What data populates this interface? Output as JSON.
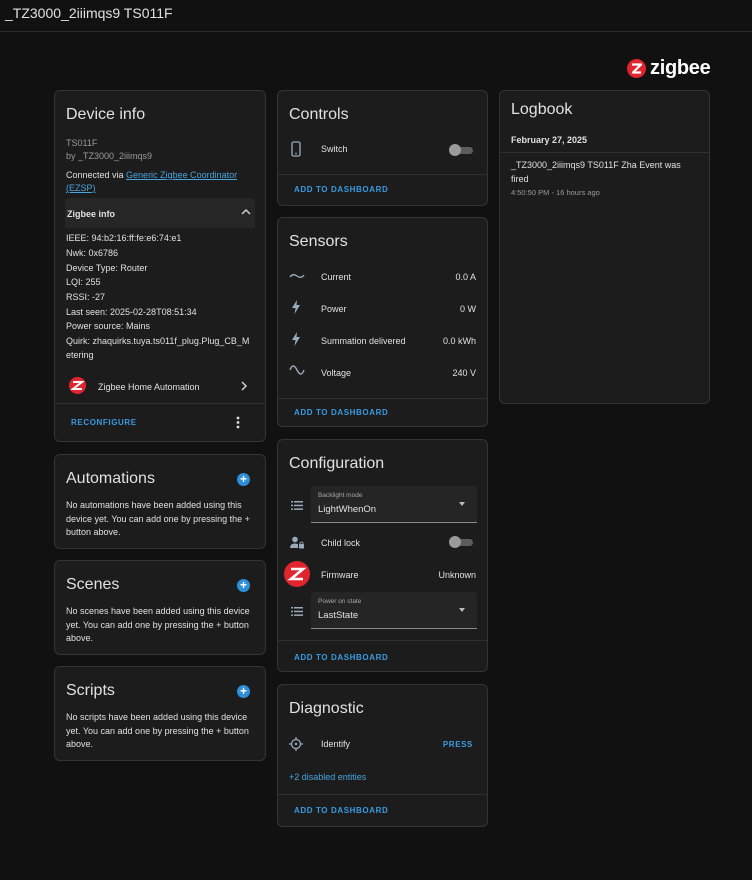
{
  "header": {
    "title": "_TZ3000_2iiimqs9 TS011F"
  },
  "brand": {
    "logo_text": "zigbee",
    "accent": "#e0252e"
  },
  "device_info": {
    "title": "Device info",
    "model": "TS011F",
    "manufacturer": "by _TZ3000_2iiimqs9",
    "connected_prefix": "Connected via ",
    "connected_link_1": "Generic Zigbee Coordinator",
    "connected_link_2": "(EZSP)",
    "zigbee_info": {
      "heading": "Zigbee info",
      "ieee": "IEEE: 94:b2:16:ff:fe:e6:74:e1",
      "nwk": "Nwk: 0x6786",
      "device_type": "Device Type: Router",
      "lqi": "LQI: 255",
      "rssi": "RSSI: -27",
      "last_seen": "Last seen: 2025-02-28T08:51:34",
      "power_source": "Power source: Mains",
      "quirk_1": "Quirk: zhaquirks.tuya.ts011f_plug.Plug_CB_M",
      "quirk_2": "etering"
    },
    "integration": "Zigbee Home Automation",
    "reconfigure": "Reconfigure"
  },
  "automations": {
    "title": "Automations",
    "text_1": "No automations have been added using this",
    "text_2": "device yet. You can add one by pressing the +",
    "text_3": "button above."
  },
  "scenes": {
    "title": "Scenes",
    "text_1": "No scenes have been added using this device",
    "text_2": "yet. You can add one by pressing the + button",
    "text_3": "above."
  },
  "scripts": {
    "title": "Scripts",
    "text_1": "No scripts have been added using this device",
    "text_2": "yet. You can add one by pressing the + button",
    "text_3": "above."
  },
  "controls": {
    "title": "Controls",
    "switch_label": "Switch",
    "add_to_dashboard": "Add to dashboard"
  },
  "sensors": {
    "title": "Sensors",
    "rows": [
      {
        "label": "Current",
        "value": "0.0 A",
        "icon": "current-ac-icon"
      },
      {
        "label": "Power",
        "value": "0 W",
        "icon": "flash-icon"
      },
      {
        "label": "Summation delivered",
        "value": "0.0 kWh",
        "icon": "lightning-icon"
      },
      {
        "label": "Voltage",
        "value": "240 V",
        "icon": "sine-wave-icon"
      }
    ],
    "add_to_dashboard": "Add to dashboard"
  },
  "configuration": {
    "title": "Configuration",
    "backlight_label": "Backlight mode",
    "backlight_value": "LightWhenOn",
    "child_lock_label": "Child lock",
    "firmware_label": "Firmware",
    "firmware_value": "Unknown",
    "power_on_label": "Power on state",
    "power_on_value": "LastState",
    "add_to_dashboard": "Add to dashboard"
  },
  "diagnostic": {
    "title": "Diagnostic",
    "identify_label": "Identify",
    "press": "Press",
    "disabled_entities": "+2 disabled entities",
    "add_to_dashboard": "Add to dashboard"
  },
  "logbook": {
    "title": "Logbook",
    "date": "February 27, 2025",
    "event_1": "_TZ3000_2iiimqs9 TS011F Zha Event was",
    "event_2": "fired",
    "time": "4:50:50 PM - 16 hours ago"
  }
}
